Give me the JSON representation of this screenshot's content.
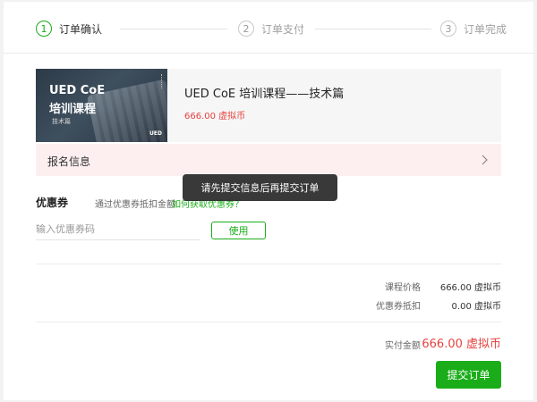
{
  "steps": [
    {
      "number": "1",
      "label": "订单确认",
      "active": true
    },
    {
      "number": "2",
      "label": "订单支付",
      "active": false
    },
    {
      "number": "3",
      "label": "订单完成",
      "active": false
    }
  ],
  "course": {
    "thumbnail": {
      "line1": "UED CoE",
      "line2": "培训课程",
      "line3": "技术篇",
      "logo": "UED"
    },
    "title": "UED CoE 培训课程——技术篇",
    "price": "666.00 虚拟币"
  },
  "registration": {
    "label": "报名信息"
  },
  "coupon": {
    "title": "优惠券",
    "hint": "通过优惠券抵扣金额",
    "link": "如何获取优惠券？",
    "placeholder": "输入优惠券码",
    "use_label": "使用"
  },
  "summary": {
    "course_price_label": "课程价格",
    "course_price_value": "666.00 虚拟币",
    "coupon_deduct_label": "优惠券抵扣",
    "coupon_deduct_value": "0.00 虚拟币",
    "actual_label": "实付金额",
    "actual_value": "666.00 虚拟币"
  },
  "submit_label": "提交订单",
  "toast": "请先提交信息后再提交订单",
  "colors": {
    "accent": "#1aad19",
    "price": "#e64340",
    "reg_bg": "#fdeff0"
  }
}
